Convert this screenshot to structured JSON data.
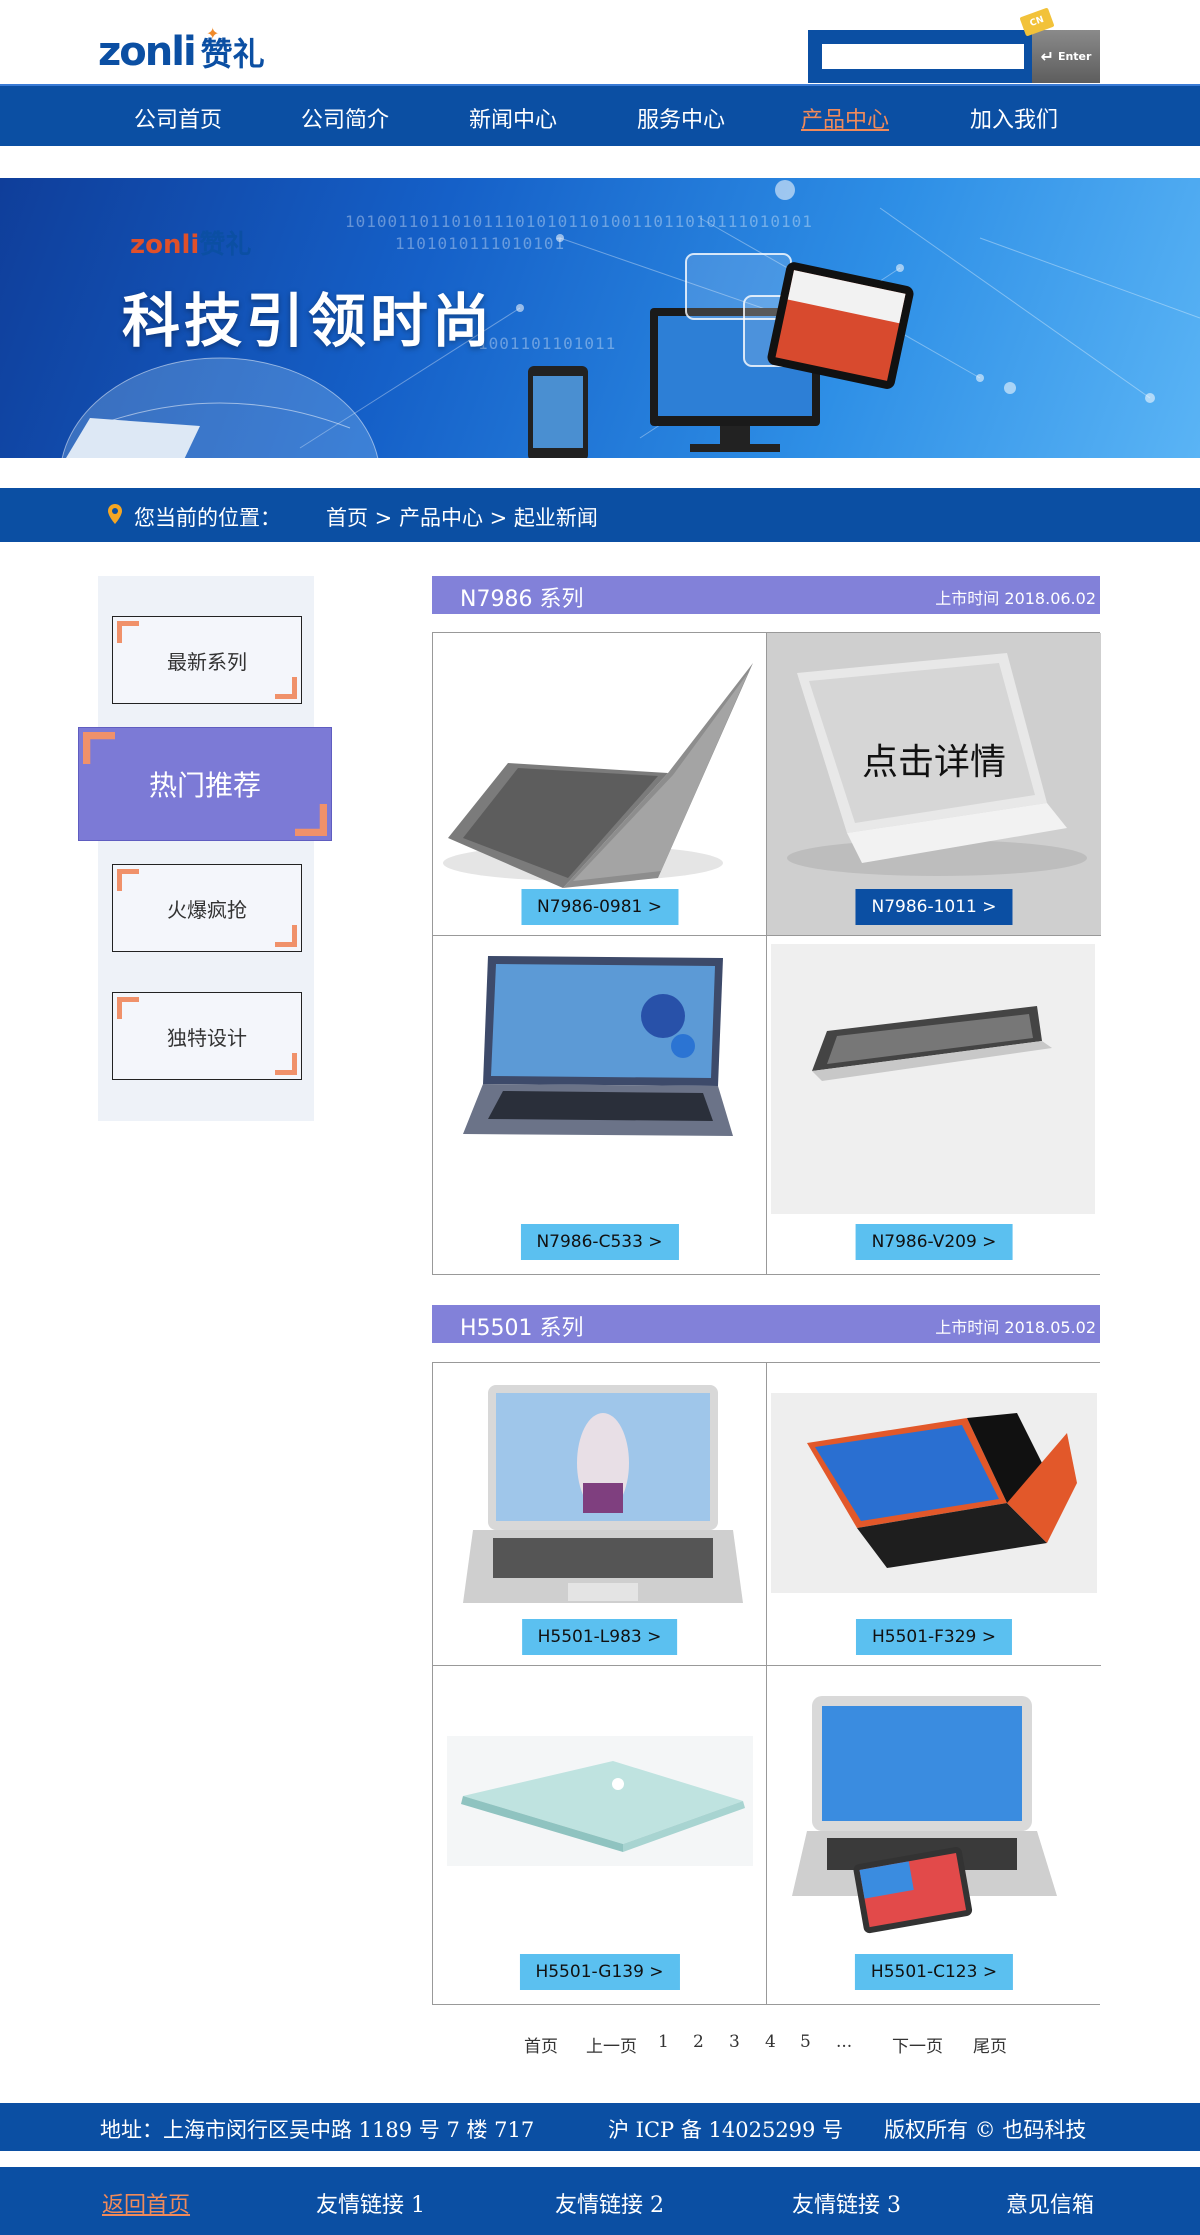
{
  "header": {
    "logo_latin": "zonli",
    "logo_cn": "赞礼",
    "search_value": "",
    "search_button": "Enter",
    "search_tag": "CN"
  },
  "nav": {
    "items": [
      {
        "label": "公司首页"
      },
      {
        "label": "公司简介"
      },
      {
        "label": "新闻中心"
      },
      {
        "label": "服务中心"
      },
      {
        "label": "产品中心",
        "active": true
      },
      {
        "label": "加入我们"
      }
    ]
  },
  "banner": {
    "logo_latin": "zonli",
    "logo_cn": "赞礼",
    "slogan": "科技引领时尚",
    "binary_1": "10100110110101110101011010011011010111010101",
    "binary_2": "1101010111010101",
    "binary_3": "1001101101011"
  },
  "breadcrumb": {
    "label": "您当前的位置：",
    "path": "首页 > 产品中心 > 起业新闻"
  },
  "sidebar": {
    "items": [
      {
        "label": "最新系列"
      },
      {
        "label": "热门推荐",
        "active": true
      },
      {
        "label": "火爆疯抢"
      },
      {
        "label": "独特设计"
      }
    ]
  },
  "series": [
    {
      "title": "N7986 系列",
      "date": "上市时间 2018.06.02",
      "products": [
        {
          "label": "N7986-0981 >"
        },
        {
          "label": "N7986-1011 >",
          "hover": true,
          "overlay": "点击详情"
        },
        {
          "label": "N7986-C533 >"
        },
        {
          "label": "N7986-V209 >"
        }
      ]
    },
    {
      "title": "H5501 系列",
      "date": "上市时间 2018.05.02",
      "products": [
        {
          "label": "H5501-L983 >"
        },
        {
          "label": "H5501-F329 >"
        },
        {
          "label": "H5501-G139 >"
        },
        {
          "label": "H5501-C123 >"
        }
      ]
    }
  ],
  "pager": {
    "first": "首页",
    "prev": "上一页",
    "pages": [
      "1",
      "2",
      "3",
      "4",
      "5"
    ],
    "ellipsis": "...",
    "next": "下一页",
    "last": "尾页"
  },
  "footer": {
    "address": "地址：上海市闵行区吴中路 1189 号 7 楼 717",
    "icp": "沪 ICP 备 14025299 号",
    "copyright": "版权所有 © 也码科技",
    "links": [
      {
        "label": "返回首页",
        "active": true
      },
      {
        "label": "友情链接 1"
      },
      {
        "label": "友情链接 2"
      },
      {
        "label": "友情链接 3"
      },
      {
        "label": "意见信箱"
      }
    ]
  },
  "colors": {
    "brand_blue": "#0b4fa3",
    "series_purple": "#8281d9",
    "label_cyan": "#5bc0f0",
    "accent_orange": "#f08a5a"
  }
}
